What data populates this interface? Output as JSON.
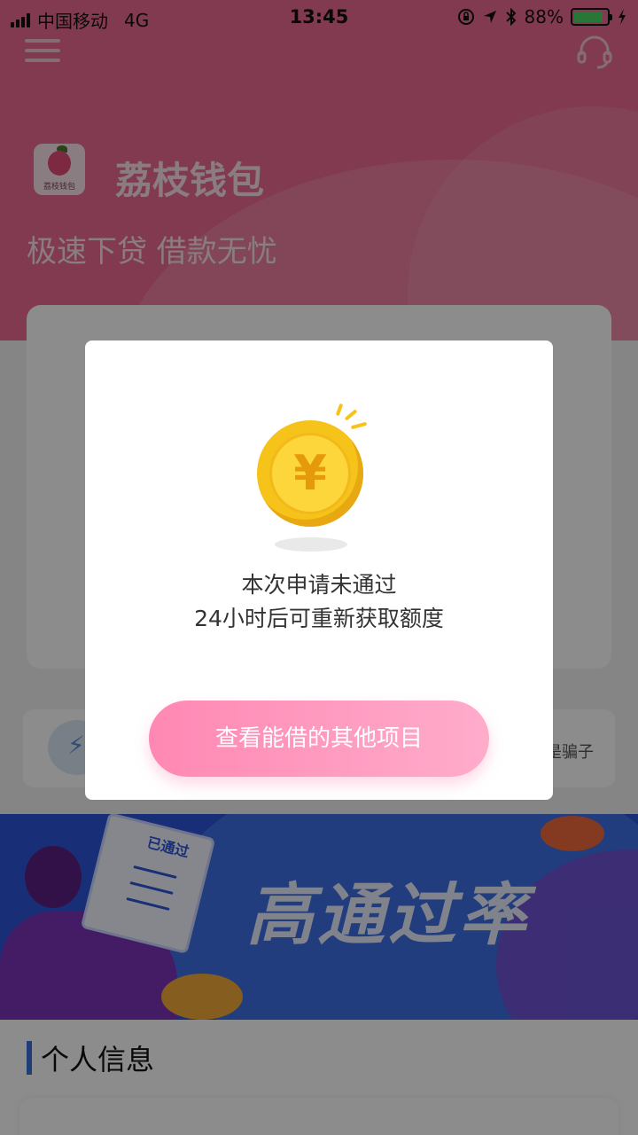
{
  "status_bar": {
    "carrier": "中国移动",
    "network": "4G",
    "time": "13:45",
    "battery_percent": "88%",
    "battery_level": 0.88
  },
  "header": {
    "app_name": "荔枝钱包",
    "logo_caption": "荔枝钱包",
    "slogan": "极速下贷 借款无忧"
  },
  "tips": {
    "trailing_text": "是骗子"
  },
  "banner": {
    "title": "高通过率",
    "paper_label": "已通过"
  },
  "section": {
    "title": "个人信息"
  },
  "dialog": {
    "coin_symbol": "¥",
    "message_line1": "本次申请未通过",
    "message_line2": "24小时后可重新获取额度",
    "action_label": "查看能借的其他项目"
  },
  "colors": {
    "hero_pink": "#ec6b93",
    "button_gradient_start": "#ff88b3",
    "button_gradient_end": "#ffaccb",
    "coin_gold": "#f6c31a",
    "banner_blue": "#2d56d9",
    "section_accent": "#3a6fd8"
  },
  "icons": {
    "menu": "menu-icon",
    "headset": "headset-icon",
    "lock_rotation": "lock-icon",
    "location": "location-icon",
    "bluetooth": "bluetooth-icon",
    "charging": "charging-icon",
    "shield": "shield-icon",
    "coin": "coin-icon"
  }
}
